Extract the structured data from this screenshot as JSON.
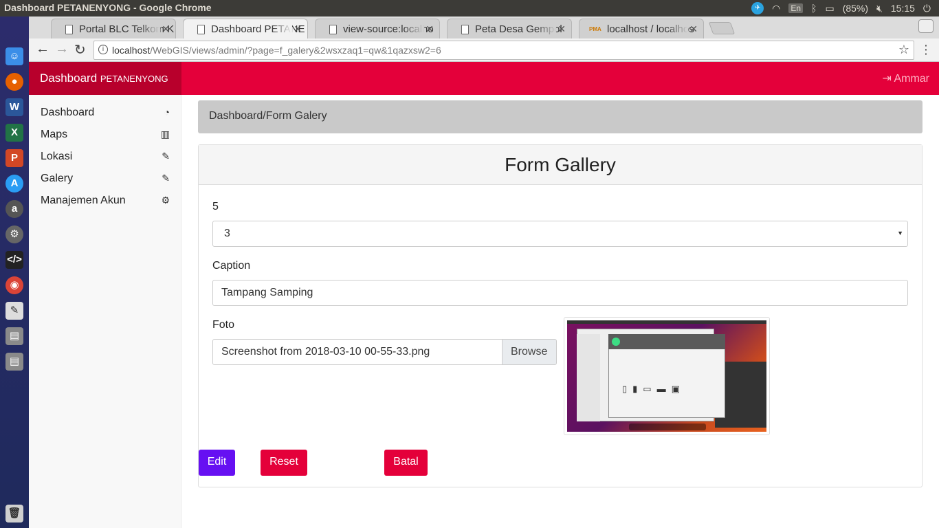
{
  "os": {
    "window_title": "Dashboard PETANENYONG - Google Chrome",
    "battery": "(85%)",
    "time": "15:15",
    "keyboard": "En"
  },
  "browser": {
    "tabs": [
      {
        "label": "Portal BLC Telkom K",
        "active": false
      },
      {
        "label": "Dashboard PETANE",
        "active": true
      },
      {
        "label": "view-source:localho",
        "active": false
      },
      {
        "label": "Peta Desa Gempol",
        "active": false
      },
      {
        "label": "localhost / localhos",
        "active": false
      }
    ],
    "url_host": "localhost",
    "url_path": "/WebGIS/views/admin/?page=f_galery&2wsxzaq1=qw&1qazxsw2=6"
  },
  "app": {
    "brand_main": "Dashboard ",
    "brand_sub": "PETANENYONG",
    "user": "Ammar"
  },
  "sidebar": {
    "items": [
      {
        "label": "Dashboard",
        "icon": "tachometer-icon"
      },
      {
        "label": "Maps",
        "icon": "map-icon"
      },
      {
        "label": "Lokasi",
        "icon": "edit-icon"
      },
      {
        "label": "Galery",
        "icon": "edit-icon"
      },
      {
        "label": "Manajemen Akun",
        "icon": "gear-icon"
      }
    ]
  },
  "breadcrumb": "Dashboard/Form Galery",
  "form": {
    "title": "Form Gallery",
    "select_label": "5",
    "select_value": "3",
    "caption_label": "Caption",
    "caption_value": "Tampang Samping",
    "foto_label": "Foto",
    "file_name": "Screenshot from 2018-03-10 00-55-33.png",
    "browse_label": "Browse",
    "buttons": {
      "edit": "Edit",
      "reset": "Reset",
      "batal": "Batal"
    }
  },
  "colors": {
    "navbar": "#e4003a",
    "brand_bg": "#b8002c",
    "edit_button": "#6610f2",
    "danger_button": "#e4003a"
  }
}
